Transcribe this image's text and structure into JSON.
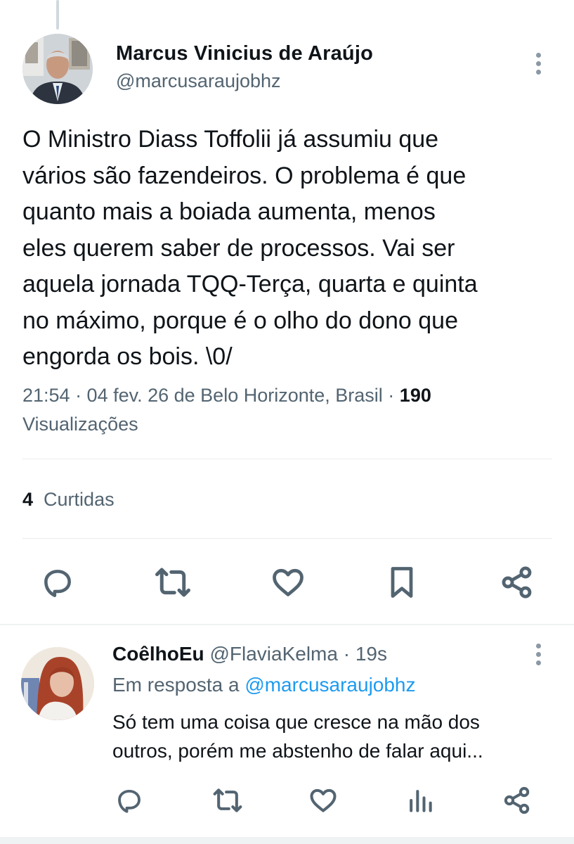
{
  "post": {
    "author_name": "Marcus Vinicius de Araújo",
    "author_handle": "@marcusaraujobhz",
    "text_lines": [
      "O Ministro Diass Toffolii já assumiu que",
      "vários são fazendeiros. O problema é que",
      "quanto mais a boiada aumenta, menos",
      "eles querem saber de processos. Vai ser",
      "aquela jornada TQQ-Terça, quarta e quinta",
      "no máximo, porque é o olho do dono que",
      "engorda os bois. \\0/"
    ],
    "meta_time": "21:54 · 04 fev. 26 de Belo Horizonte, Brasil · ",
    "views_count": "190",
    "views_label": "Visualizações",
    "likes_count": "4",
    "likes_label": "Curtidas",
    "actions": [
      "reply-icon",
      "repost-icon",
      "like-icon",
      "bookmark-icon",
      "share-icon"
    ]
  },
  "reply": {
    "author_name": "CoêlhoEu",
    "author_handle": "@FlaviaKelma",
    "time": "· 19s",
    "reply_to_prefix": "Em resposta a",
    "reply_to_handle": "@marcusaraujobhz",
    "text_lines": [
      "Só tem uma coisa que cresce na mão dos",
      "outros, porém me abstenho de falar aqui..."
    ],
    "actions": [
      "reply-icon",
      "repost-icon",
      "like-icon",
      "views-icon",
      "share-icon"
    ]
  },
  "colors": {
    "text_primary": "#0f1419",
    "text_secondary": "#536471",
    "link": "#1d9bf0",
    "divider": "#e7ebee"
  }
}
